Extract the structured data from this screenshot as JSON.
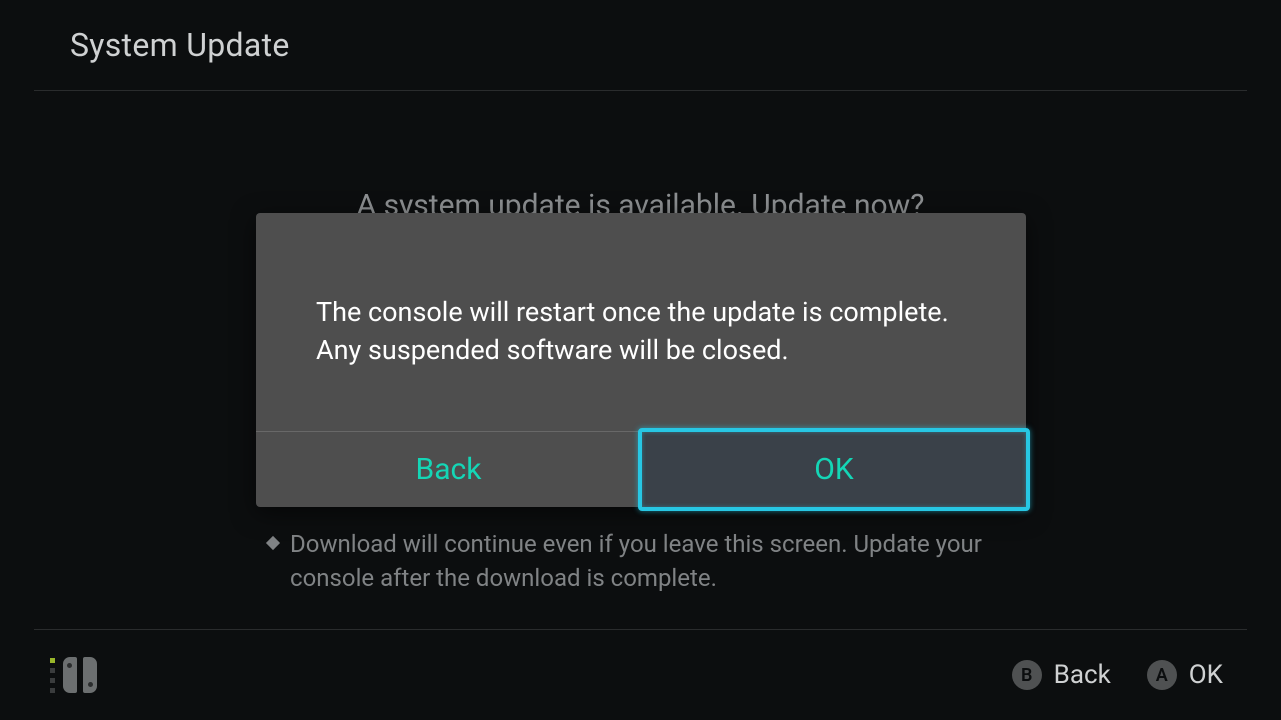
{
  "header": {
    "title": "System Update"
  },
  "background": {
    "prompt": "A system update is available. Update now?"
  },
  "dialog": {
    "line1": "The console will restart once the update is complete.",
    "line2": "Any suspended software will be closed.",
    "back_label": "Back",
    "ok_label": "OK"
  },
  "note": {
    "text": "Download will continue even if you leave this screen. Update your console after the download is complete."
  },
  "footer": {
    "hint_b_key": "B",
    "hint_b_label": "Back",
    "hint_a_key": "A",
    "hint_a_label": "OK"
  }
}
